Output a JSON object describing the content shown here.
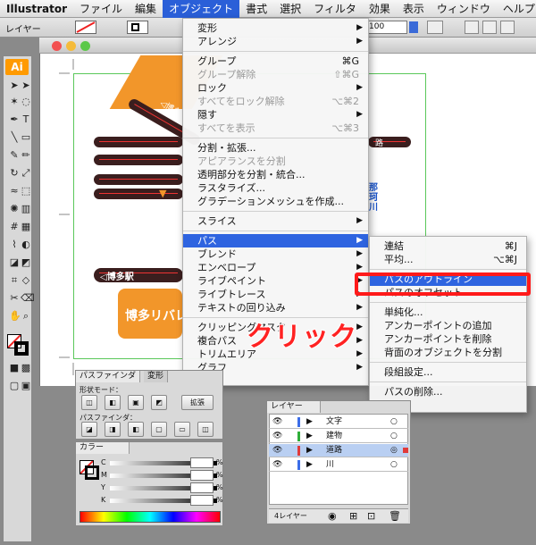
{
  "menubar": {
    "items": [
      "Illustrator",
      "ファイル",
      "編集",
      "オブジェクト",
      "書式",
      "選択",
      "フィルタ",
      "効果",
      "表示",
      "ウィンドウ",
      "ヘルプ"
    ],
    "active_index": 3
  },
  "control_bar": {
    "label": "レイヤー",
    "opacity": "100"
  },
  "object_menu": {
    "items": [
      {
        "label": "変形",
        "shortcut": "",
        "submenu": true,
        "disabled": false
      },
      {
        "label": "アレンジ",
        "shortcut": "",
        "submenu": true,
        "disabled": false
      },
      {
        "sep": true
      },
      {
        "label": "グループ",
        "shortcut": "⌘G",
        "disabled": false
      },
      {
        "label": "グループ解除",
        "shortcut": "⇧⌘G",
        "disabled": true
      },
      {
        "label": "ロック",
        "shortcut": "",
        "submenu": true,
        "disabled": false
      },
      {
        "label": "すべてをロック解除",
        "shortcut": "⌥⌘2",
        "disabled": true
      },
      {
        "label": "隠す",
        "shortcut": "",
        "submenu": true,
        "disabled": false
      },
      {
        "label": "すべてを表示",
        "shortcut": "⌥⌘3",
        "disabled": true
      },
      {
        "sep": true
      },
      {
        "label": "分割・拡張...",
        "shortcut": "",
        "disabled": false
      },
      {
        "label": "アピアランスを分割",
        "shortcut": "",
        "disabled": true
      },
      {
        "label": "透明部分を分割・統合...",
        "shortcut": "",
        "disabled": false
      },
      {
        "label": "ラスタライズ...",
        "shortcut": "",
        "disabled": false
      },
      {
        "label": "グラデーションメッシュを作成...",
        "shortcut": "",
        "disabled": false
      },
      {
        "sep": true
      },
      {
        "label": "スライス",
        "shortcut": "",
        "submenu": true,
        "disabled": false
      },
      {
        "sep": true
      },
      {
        "label": "パス",
        "shortcut": "",
        "submenu": true,
        "disabled": false,
        "highlight": true
      },
      {
        "label": "ブレンド",
        "shortcut": "",
        "submenu": true,
        "disabled": false
      },
      {
        "label": "エンベロープ",
        "shortcut": "",
        "submenu": true,
        "disabled": false
      },
      {
        "label": "ライブペイント",
        "shortcut": "",
        "submenu": true,
        "disabled": false
      },
      {
        "label": "ライブトレース",
        "shortcut": "",
        "submenu": true,
        "disabled": false
      },
      {
        "label": "テキストの回り込み",
        "shortcut": "",
        "submenu": true,
        "disabled": false
      },
      {
        "sep": true
      },
      {
        "label": "クリッピングマスク",
        "shortcut": "",
        "submenu": true,
        "disabled": false
      },
      {
        "label": "複合パス",
        "shortcut": "",
        "submenu": true,
        "disabled": false
      },
      {
        "label": "トリムエリア",
        "shortcut": "",
        "submenu": true,
        "disabled": false
      },
      {
        "label": "グラフ",
        "shortcut": "",
        "submenu": true,
        "disabled": false
      }
    ]
  },
  "path_submenu": {
    "items": [
      {
        "label": "連結",
        "shortcut": "⌘J"
      },
      {
        "label": "平均...",
        "shortcut": "⌥⌘J"
      },
      {
        "sep": true
      },
      {
        "label": "パスのアウトライン",
        "shortcut": "",
        "highlight": true
      },
      {
        "label": "パスのオフセット...",
        "shortcut": ""
      },
      {
        "sep": true
      },
      {
        "label": "単純化...",
        "shortcut": ""
      },
      {
        "label": "アンカーポイントの追加",
        "shortcut": ""
      },
      {
        "label": "アンカーポイントを削除",
        "shortcut": ""
      },
      {
        "label": "背面のオブジェクトを分割",
        "shortcut": ""
      },
      {
        "sep": true
      },
      {
        "label": "段組設定...",
        "shortcut": ""
      },
      {
        "sep": true
      },
      {
        "label": "パスの削除...",
        "shortcut": ""
      }
    ]
  },
  "callout": {
    "label": "クリック"
  },
  "artwork": {
    "station_label": "◁博多駅",
    "station_label2": "◁博多駅",
    "river_label": "博多リバレ",
    "vertical_text": "那珂川",
    "road_text": "路"
  },
  "pathfinder_panel": {
    "tabs": [
      "パスファインダ",
      "変形"
    ],
    "shape_mode_label": "形状モード：",
    "pathfinder_label": "パスファインダ：",
    "expand_label": "拡張"
  },
  "color_panel": {
    "tab": "カラー",
    "channels": [
      "C",
      "M",
      "Y",
      "K"
    ],
    "pct": "%"
  },
  "layers_panel": {
    "tab": "レイヤー",
    "layers": [
      {
        "name": "文字",
        "color": "#3c6ee8",
        "selected": false
      },
      {
        "name": "建物",
        "color": "#2fae3a",
        "selected": false
      },
      {
        "name": "道路",
        "color": "#e03a3a",
        "selected": true
      },
      {
        "name": "川",
        "color": "#3c6ee8",
        "selected": false
      }
    ],
    "footer": "4レイヤー"
  },
  "colors": {
    "accent": "#2e64e0",
    "callout": "#ff1a1a",
    "orange": "#f2962a",
    "road": "#3a1e1e"
  }
}
